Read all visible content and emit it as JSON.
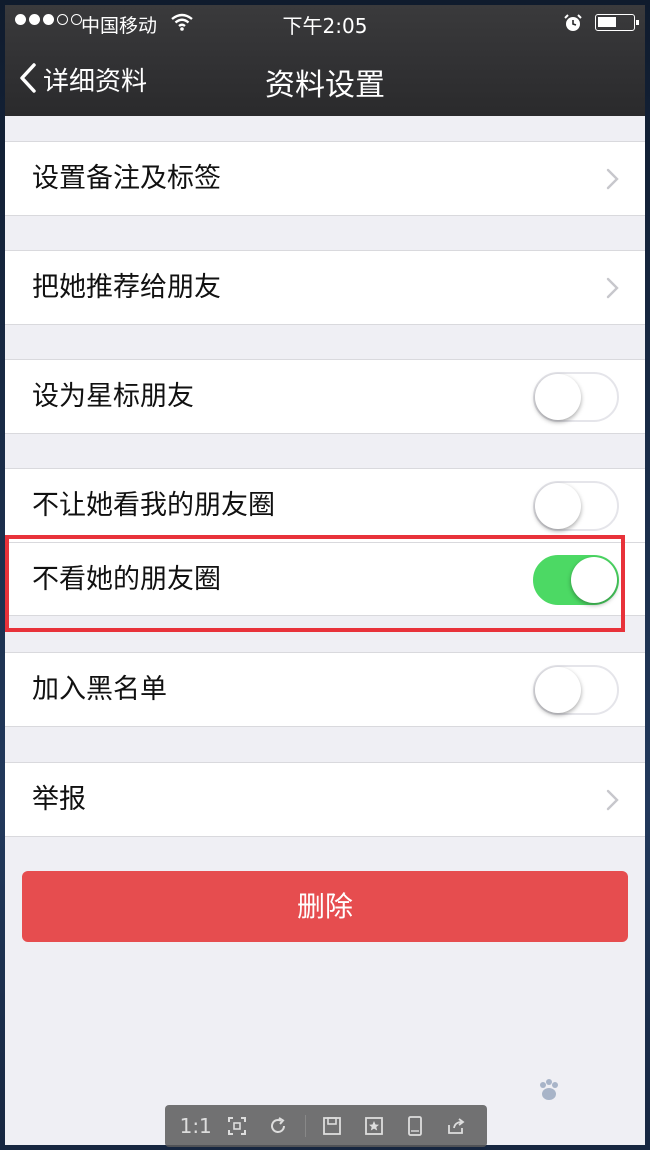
{
  "status_bar": {
    "carrier": "中国移动",
    "time": "下午2:05"
  },
  "nav": {
    "back_label": "详细资料",
    "title": "资料设置"
  },
  "settings": {
    "remark_label": "设置备注及标签",
    "recommend_label": "把她推荐给朋友",
    "star_label": "设为星标朋友",
    "hide_my_moments_label": "不让她看我的朋友圈",
    "hide_her_moments_label": "不看她的朋友圈",
    "blacklist_label": "加入黑名单",
    "report_label": "举报"
  },
  "toggles": {
    "star": false,
    "hide_my_moments": false,
    "hide_her_moments": true,
    "blacklist": false
  },
  "delete_button": "删除",
  "viewer_toolbar": {
    "zoom_label": "1:1"
  },
  "colors": {
    "switch_on": "#4cd964",
    "delete": "#e64d4f",
    "highlight": "#e8323a"
  }
}
